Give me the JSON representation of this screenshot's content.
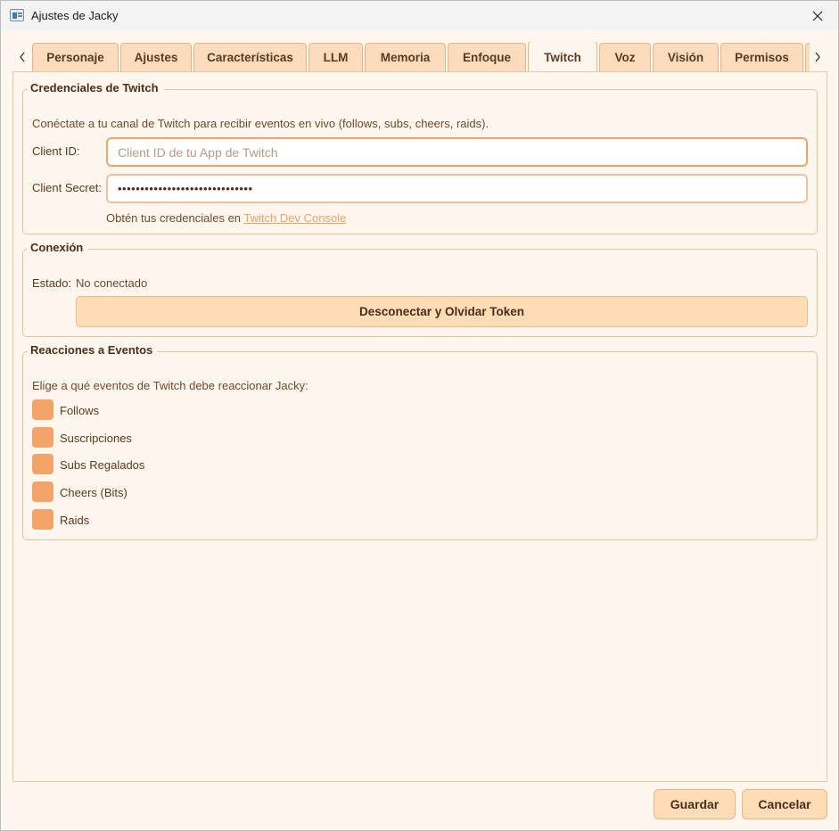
{
  "window": {
    "title": "Ajustes de Jacky",
    "app_icon": "app-window-icon",
    "close_icon": "close-icon"
  },
  "tabs": {
    "prev_icon": "chevron-left-icon",
    "next_icon": "chevron-right-icon",
    "items": [
      {
        "label": "Personaje"
      },
      {
        "label": "Ajustes"
      },
      {
        "label": "Características"
      },
      {
        "label": "LLM"
      },
      {
        "label": "Memoria"
      },
      {
        "label": "Enfoque"
      },
      {
        "label": "Twitch",
        "active": true
      },
      {
        "label": "Voz"
      },
      {
        "label": "Visión"
      },
      {
        "label": "Permisos"
      },
      {
        "label": ""
      }
    ]
  },
  "credentials": {
    "title": "Credenciales de Twitch",
    "description": "Conéctate a tu canal de Twitch para recibir eventos en vivo (follows, subs, cheers, raids).",
    "client_id_label": "Client ID:",
    "client_id_value": "",
    "client_id_placeholder": "Client ID de tu App de Twitch",
    "client_secret_label": "Client Secret:",
    "client_secret_value": "••••••••••••••••••••••••••••••",
    "help_prefix": "Obtén tus credenciales en",
    "help_link": "Twitch Dev Console"
  },
  "connection": {
    "title": "Conexión",
    "status_label": "Estado:",
    "status_value": "No conectado",
    "disconnect_button": "Desconectar y Olvidar Token"
  },
  "events": {
    "title": "Reacciones a Eventos",
    "description": "Elige a qué eventos de Twitch debe reaccionar Jacky:",
    "items": [
      {
        "label": "Follows",
        "checked": false
      },
      {
        "label": "Suscripciones",
        "checked": false
      },
      {
        "label": "Subs Regalados",
        "checked": false
      },
      {
        "label": "Cheers (Bits)",
        "checked": false
      },
      {
        "label": "Raids",
        "checked": false
      }
    ]
  },
  "footer": {
    "save_label": "Guardar",
    "cancel_label": "Cancelar"
  },
  "colors": {
    "background": "#fff6ee",
    "tab": "#fcdcbc",
    "accent": "#f4a469",
    "link": "#e9a463",
    "text": "#5a3a20"
  }
}
